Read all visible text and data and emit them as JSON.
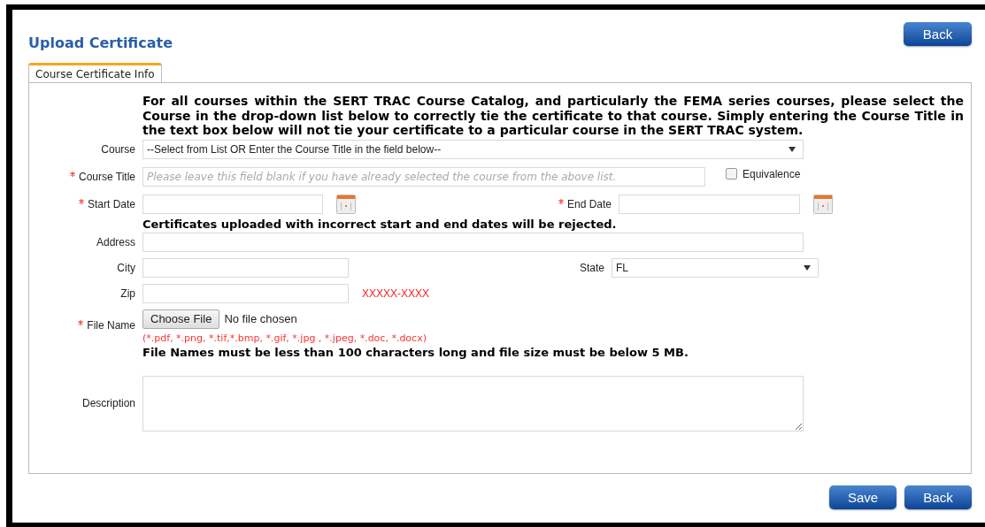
{
  "header": {
    "title": "Upload Certificate",
    "back_button": "Back"
  },
  "tabs": [
    {
      "label": "Course Certificate Info",
      "selected": true
    }
  ],
  "form": {
    "intro": "For all courses within the SERT TRAC Course Catalog, and particularly the FEMA series courses, please select the Course in the drop-down list below to correctly tie the certificate to that course. Simply entering the Course Title in the text box below will not tie your certificate to a particular course in the SERT TRAC system.",
    "course": {
      "label": "Course",
      "required": false,
      "value": "--Select from List OR Enter the Course Title in the field below--"
    },
    "course_title": {
      "label": "Course Title",
      "required": true,
      "placeholder": "Please leave this field blank if you have already selected the course from the above list."
    },
    "equivalence": {
      "label": "Equivalence",
      "checked": false
    },
    "start_date": {
      "label": "Start Date",
      "required": true
    },
    "end_date": {
      "label": "End Date",
      "required": true
    },
    "date_note": "Certificates uploaded with incorrect start and end dates will be rejected.",
    "address": {
      "label": "Address",
      "required": false
    },
    "city": {
      "label": "City",
      "required": false
    },
    "state": {
      "label": "State",
      "required": false,
      "value": "FL"
    },
    "zip": {
      "label": "Zip",
      "required": false,
      "hint": "XXXXX-XXXX"
    },
    "file": {
      "label": "File Name",
      "required": true,
      "button": "Choose File",
      "status": "No file chosen",
      "types": "(*.pdf, *.png, *.tif,*.bmp, *.gif, *.jpg , *.jpeg, *.doc, *.docx)"
    },
    "file_note": "File Names must be less than 100 characters long and file size must be below 5 MB.",
    "description": {
      "label": "Description",
      "required": false
    }
  },
  "buttons": [
    "Save",
    "Back"
  ]
}
